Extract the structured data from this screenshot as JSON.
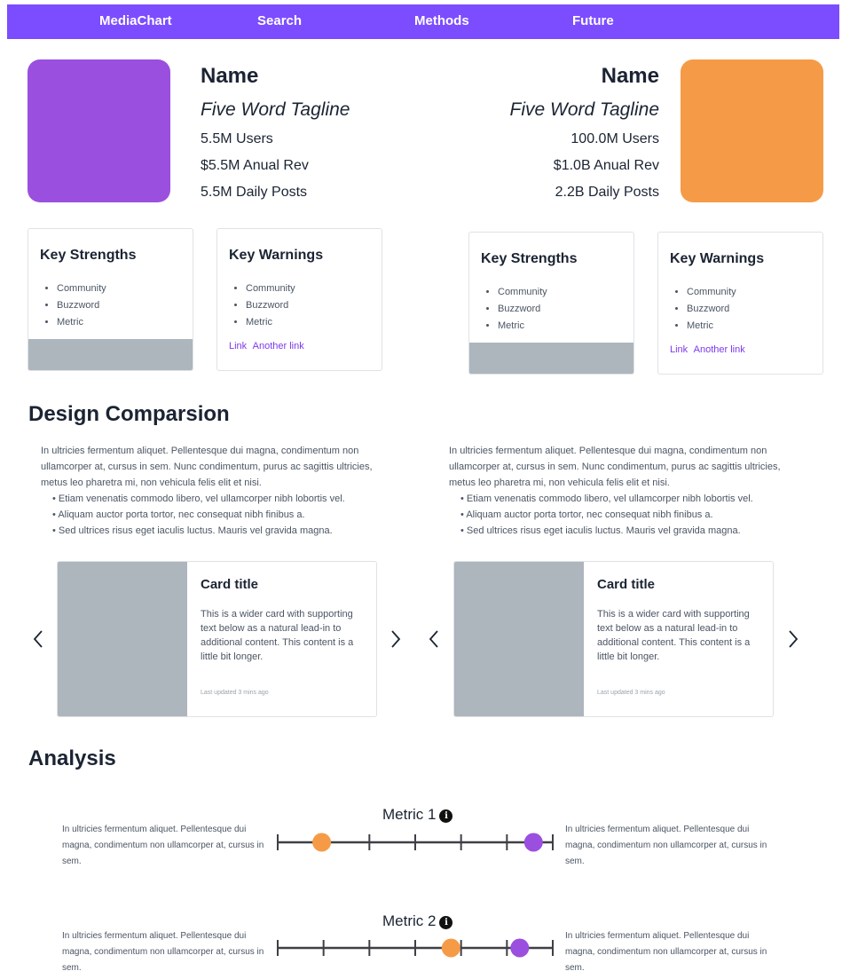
{
  "nav": {
    "items": [
      "MediaChart",
      "Search",
      "Methods",
      "Future"
    ]
  },
  "colors": {
    "nav": "#7c4dff",
    "purple": "#9b4fdf",
    "orange": "#f59b47",
    "placeholder": "#adb5bd",
    "link": "#7c3aed"
  },
  "left_profile": {
    "name": "Name",
    "tagline": "Five Word Tagline",
    "users": "5.5M Users",
    "revenue": "$5.5M Anual Rev",
    "posts": "5.5M Daily Posts"
  },
  "right_profile": {
    "name": "Name",
    "tagline": "Five Word Tagline",
    "users": "100.0M Users",
    "revenue": "$1.0B Anual Rev",
    "posts": "2.2B Daily Posts"
  },
  "key_cards": [
    {
      "title": "Key Strengths",
      "items": [
        "Community",
        "Buzzword",
        "Metric"
      ]
    },
    {
      "title": "Key Warnings",
      "items": [
        "Community",
        "Buzzword",
        "Metric"
      ],
      "links": [
        "Link",
        "Another link"
      ]
    },
    {
      "title": "Key Strengths",
      "items": [
        "Community",
        "Buzzword",
        "Metric"
      ]
    },
    {
      "title": "Key Warnings",
      "items": [
        "Community",
        "Buzzword",
        "Metric"
      ],
      "links": [
        "Link",
        "Another link"
      ]
    }
  ],
  "design": {
    "title": "Design Comparsion",
    "columns": [
      {
        "paragraph": "In ultricies fermentum aliquet. Pellentesque dui magna, condimentum non ullamcorper at, cursus in sem. Nunc condimentum, purus ac sagittis ultricies, metus leo pharetra mi, non vehicula felis elit et nisi.",
        "bullets": [
          "Etiam venenatis commodo libero, vel ullamcorper nibh lobortis vel.",
          "Aliquam auctor porta tortor, nec consequat nibh finibus a.",
          "Sed ultrices risus eget iaculis luctus. Mauris vel gravida magna."
        ]
      },
      {
        "paragraph": "In ultricies fermentum aliquet. Pellentesque dui magna, condimentum non ullamcorper at, cursus in sem. Nunc condimentum, purus ac sagittis ultricies, metus leo pharetra mi, non vehicula felis elit et nisi.",
        "bullets": [
          "Etiam venenatis commodo libero, vel ullamcorper nibh lobortis vel.",
          "Aliquam auctor porta tortor, nec consequat nibh finibus a.",
          "Sed ultrices risus eget iaculis luctus. Mauris vel gravida magna."
        ]
      }
    ],
    "cards": [
      {
        "title": "Card title",
        "text": "This is a wider card with supporting text below as a natural lead-in to additional content. This content is a little bit longer.",
        "meta": "Last updated 3 mins ago"
      },
      {
        "title": "Card title",
        "text": "This is a wider card with supporting text below as a natural lead-in to additional content. This content is a little bit longer.",
        "meta": "Last updated 3 mins ago"
      }
    ]
  },
  "analysis": {
    "title": "Analysis",
    "metrics": [
      {
        "label": "Metric 1",
        "left_text": "In ultricies fermentum aliquet. Pellentesque dui magna, condimentum non ullamcorper at, cursus in sem.",
        "right_text": "In ultricies fermentum aliquet. Pellentesque dui magna, condimentum non ullamcorper at, cursus in sem.",
        "orange_value": 0.16,
        "purple_value": 0.93
      },
      {
        "label": "Metric 2",
        "left_text": "In ultricies fermentum aliquet. Pellentesque dui magna, condimentum non ullamcorper at, cursus in sem.",
        "right_text": "In ultricies fermentum aliquet. Pellentesque dui magna, condimentum non ullamcorper at, cursus in sem.",
        "orange_value": 0.63,
        "purple_value": 0.88
      }
    ]
  }
}
